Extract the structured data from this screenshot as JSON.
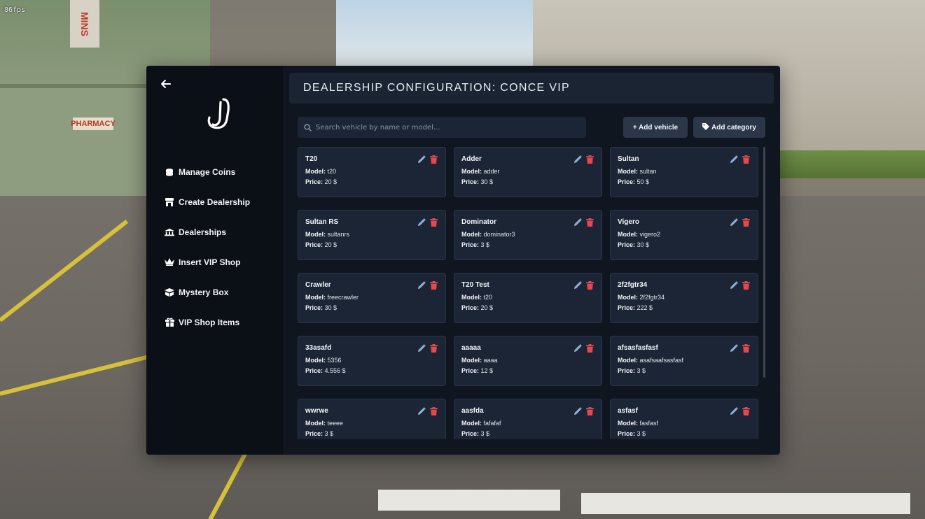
{
  "overlay": {
    "fps": "86fps"
  },
  "backdrop": {
    "sign_mins": "MINS",
    "sign_pharmacy": "PHARMACY"
  },
  "sidebar": {
    "items": [
      {
        "label": "Manage Coins",
        "icon": "coins-icon"
      },
      {
        "label": "Create Dealership",
        "icon": "store-icon"
      },
      {
        "label": "Dealerships",
        "icon": "bank-icon"
      },
      {
        "label": "Insert VIP Shop",
        "icon": "crown-icon"
      },
      {
        "label": "Mystery Box",
        "icon": "box-icon"
      },
      {
        "label": "VIP Shop Items",
        "icon": "gift-icon"
      }
    ]
  },
  "header": {
    "title": "DEALERSHIP CONFIGURATION: CONCE VIP"
  },
  "toolbar": {
    "search_placeholder": "Search vehicle by name or model...",
    "add_vehicle_label": "+ Add vehicle",
    "add_category_label": "Add category"
  },
  "labels": {
    "model": "Model:",
    "price": "Price:"
  },
  "vehicles": [
    {
      "name": "T20",
      "model": "t20",
      "price": "20 $"
    },
    {
      "name": "Adder",
      "model": "adder",
      "price": "30 $"
    },
    {
      "name": "Sultan",
      "model": "sultan",
      "price": "50 $"
    },
    {
      "name": "Sultan RS",
      "model": "sultanrs",
      "price": "20 $"
    },
    {
      "name": "Dominator",
      "model": "dominator3",
      "price": "3 $"
    },
    {
      "name": "Vigero",
      "model": "vigero2",
      "price": "30 $"
    },
    {
      "name": "Crawler",
      "model": "freecrawler",
      "price": "30 $"
    },
    {
      "name": "T20 Test",
      "model": "t20",
      "price": "20 $"
    },
    {
      "name": "2f2fgtr34",
      "model": "2f2fgtr34",
      "price": "222 $"
    },
    {
      "name": "33asafd",
      "model": "5356",
      "price": "4.556 $"
    },
    {
      "name": "aaaaa",
      "model": "aaaa",
      "price": "12 $"
    },
    {
      "name": "afsasfasfasf",
      "model": "asafsaafsasfasf",
      "price": "3 $"
    },
    {
      "name": "wwrwe",
      "model": "teeee",
      "price": "3 $"
    },
    {
      "name": "aasfda",
      "model": "fafafaf",
      "price": "3 $"
    },
    {
      "name": "asfasf",
      "model": "fasfasf",
      "price": "3 $"
    }
  ],
  "colors": {
    "panel": "#0f1620",
    "sidebar": "#0b1016",
    "card": "#1c2536",
    "edit": "#8fb0d6",
    "delete": "#e5484d"
  }
}
